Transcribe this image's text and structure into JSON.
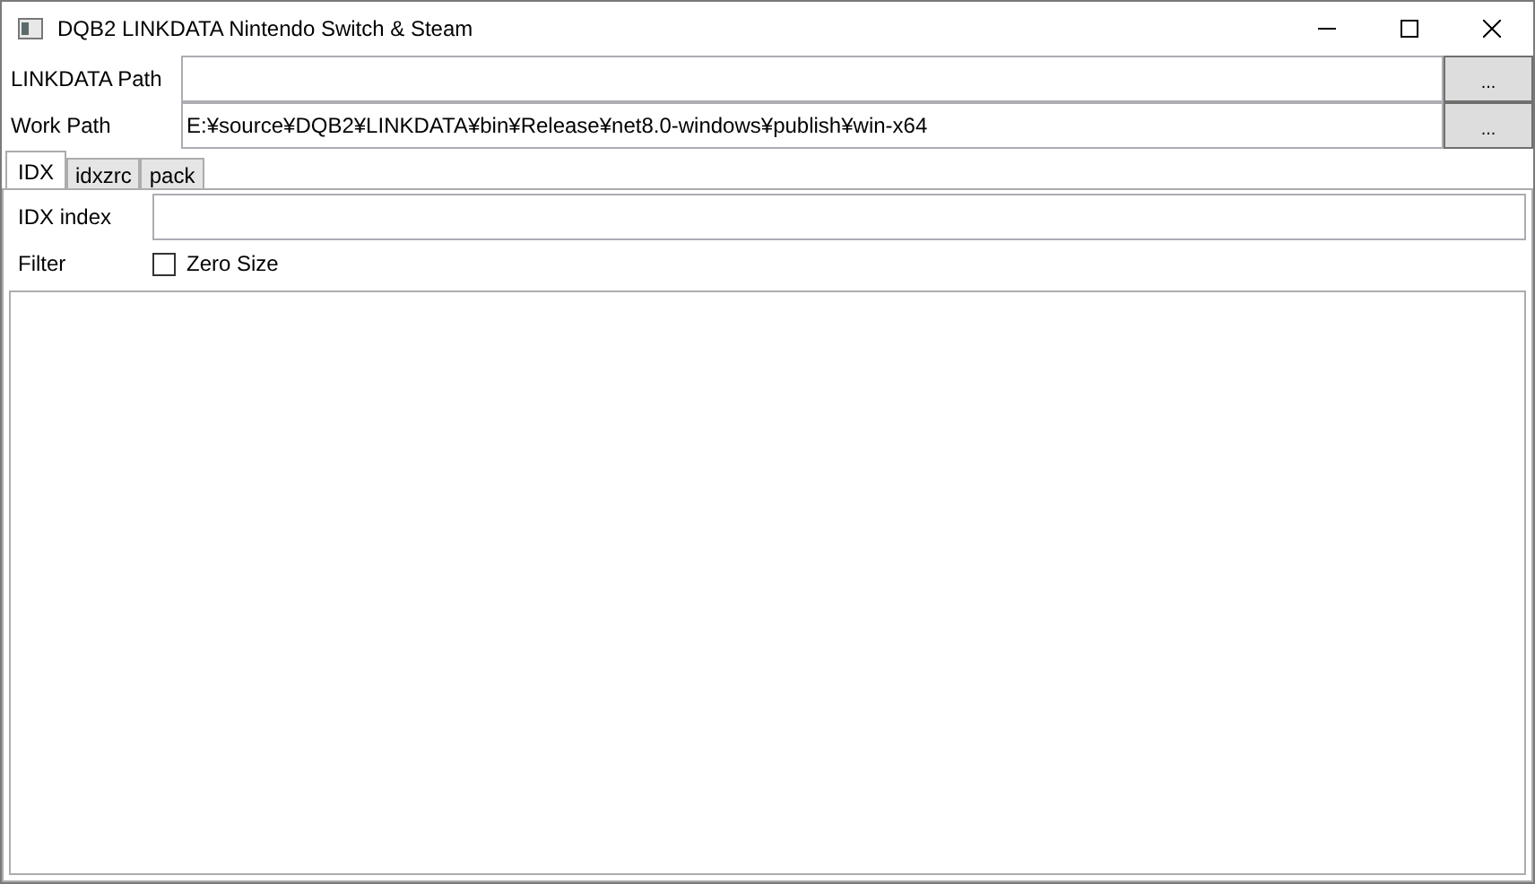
{
  "window": {
    "title": "DQB2 LINKDATA Nintendo Switch & Steam"
  },
  "paths": [
    {
      "label": "LINKDATA Path",
      "button": "..."
    },
    {
      "label": "Work Path",
      "value": "E:¥source¥DQB2¥LINKDATA¥bin¥Release¥net8.0-windows¥publish¥win-x64",
      "button": "..."
    }
  ],
  "tabs": [
    {
      "label": "IDX",
      "selected": true
    },
    {
      "label": "idxzrc",
      "selected": false
    },
    {
      "label": "pack",
      "selected": false
    }
  ],
  "idx": {
    "index_label": "IDX index",
    "filter_label": "Filter",
    "zero_size": {
      "label": "Zero Size",
      "checked": false
    }
  }
}
